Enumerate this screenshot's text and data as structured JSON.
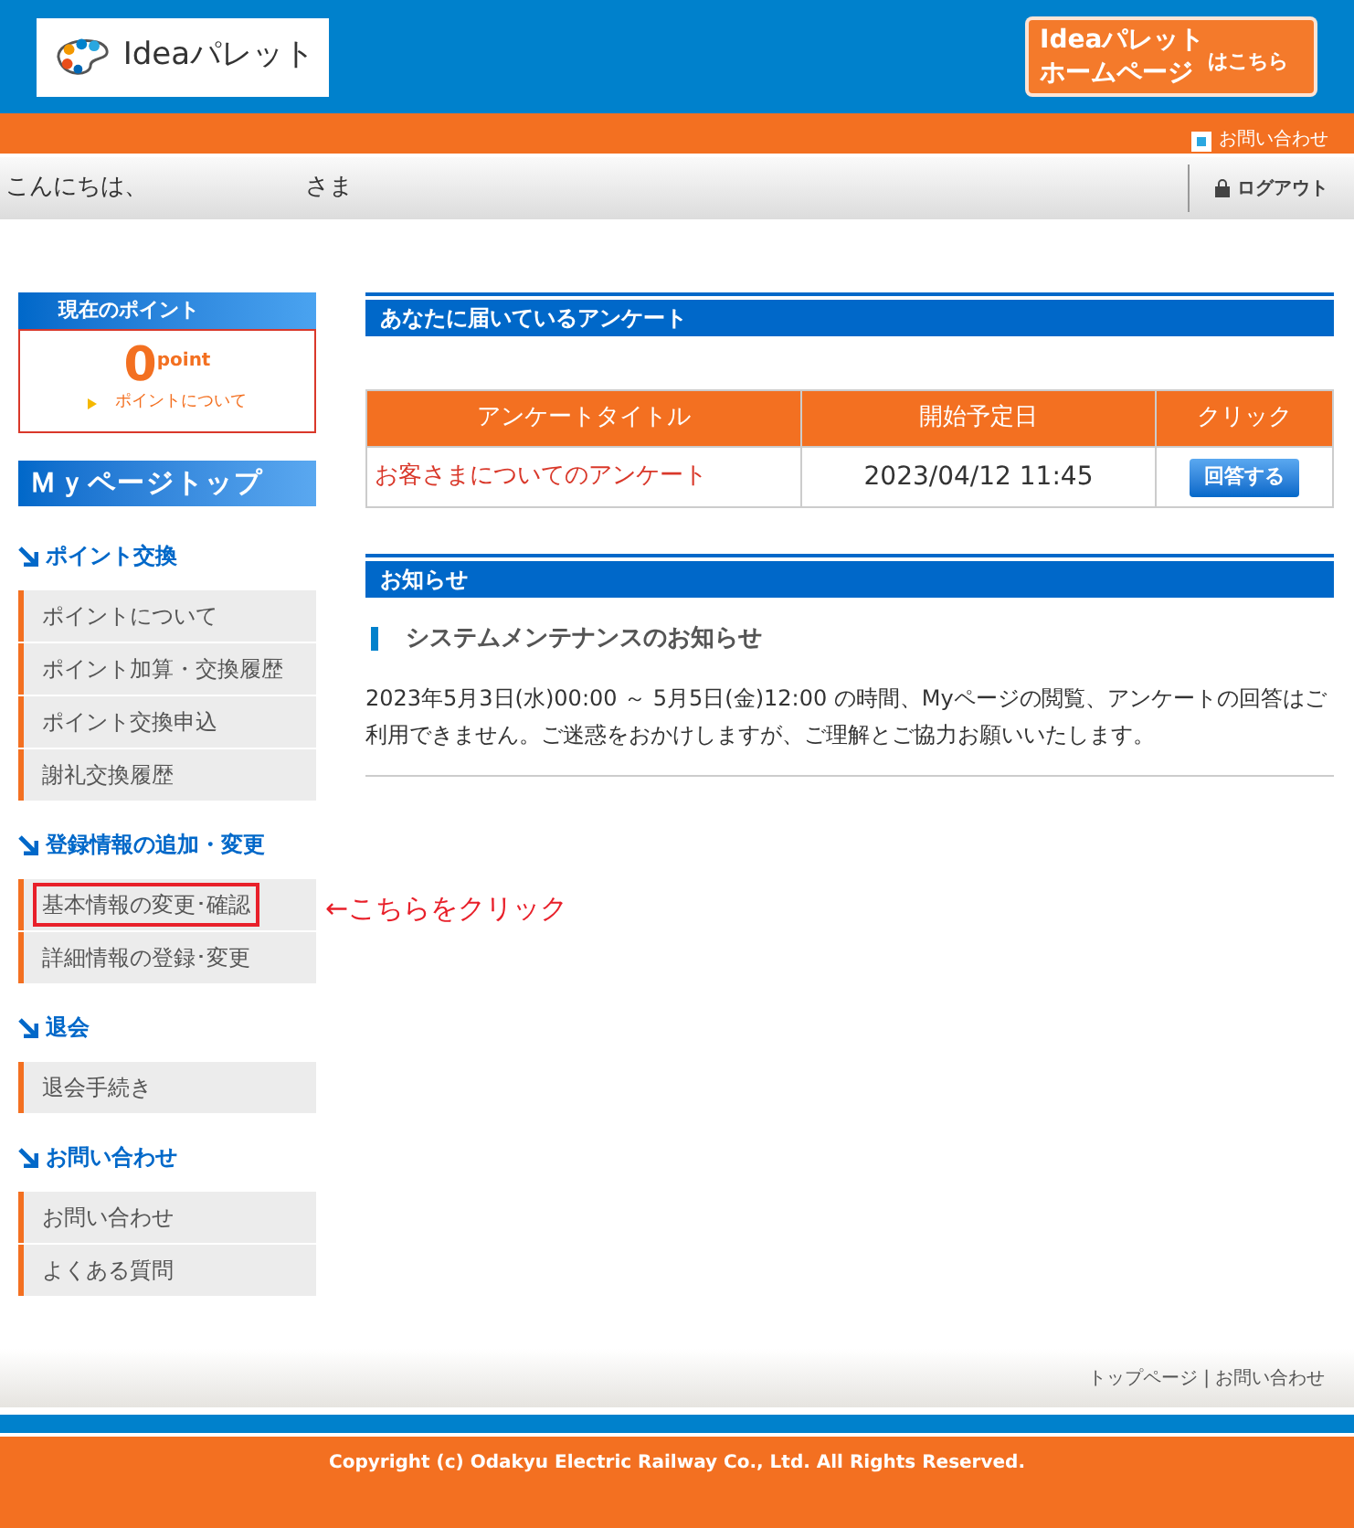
{
  "header": {
    "logo_text": "Ideaパレット",
    "banner": {
      "line_1": "Ideaパレット",
      "line_2": "ホームページ",
      "suffix": "はこちら"
    },
    "contact_link": "お問い合わせ"
  },
  "greeting_bar": {
    "greeting": "こんにちは、",
    "honorific": "さま",
    "logout": "ログアウト"
  },
  "sidebar": {
    "points": {
      "title": "現在のポイント",
      "value": "0",
      "unit": "point",
      "link": "ポイントについて"
    },
    "top_button": "Ｍｙページトップ",
    "sections": [
      {
        "title": "ポイント交換",
        "items": [
          {
            "label": "ポイントについて",
            "highlighted": false
          },
          {
            "label": "ポイント加算・交換履歴",
            "highlighted": false
          },
          {
            "label": "ポイント交換申込",
            "highlighted": false
          },
          {
            "label": "謝礼交換履歴",
            "highlighted": false
          }
        ]
      },
      {
        "title": "登録情報の追加・変更",
        "items": [
          {
            "label": "基本情報の変更･確認",
            "highlighted": true
          },
          {
            "label": "詳細情報の登録･変更",
            "highlighted": false
          }
        ]
      },
      {
        "title": "退会",
        "items": [
          {
            "label": "退会手続き",
            "highlighted": false
          }
        ]
      },
      {
        "title": "お問い合わせ",
        "items": [
          {
            "label": "お問い合わせ",
            "highlighted": false
          },
          {
            "label": "よくある質問",
            "highlighted": false
          }
        ]
      }
    ]
  },
  "annotation": "←こちらをクリック",
  "surveys": {
    "title": "あなたに届いているアンケート",
    "columns": [
      "アンケートタイトル",
      "開始予定日",
      "クリック"
    ],
    "rows": [
      {
        "title": "お客さまについてのアンケート",
        "start": "2023/04/12 11:45",
        "button": "回答する"
      }
    ]
  },
  "notices": {
    "title": "お知らせ",
    "items": [
      {
        "heading": "システムメンテナンスのお知らせ",
        "body": "2023年5月3日(水)00:00 ～ 5月5日(金)12:00 の時間、Myページの閲覧、アンケートの回答はご利用できません。ご迷惑をおかけしますが、ご理解とご協力お願いいたします。"
      }
    ]
  },
  "footer": {
    "links": [
      "トップページ",
      "お問い合わせ"
    ],
    "separator": "|",
    "copyright": "Copyright (c) Odakyu Electric Railway Co., Ltd. All Rights Reserved."
  }
}
